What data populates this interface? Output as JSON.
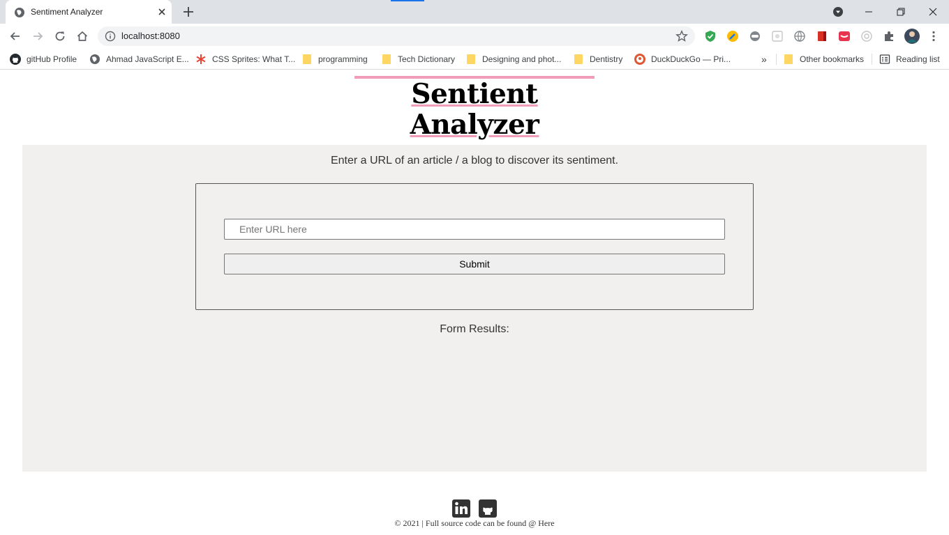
{
  "browser": {
    "tab_title": "Sentiment Analyzer",
    "address": "localhost:8080",
    "bookmarks": [
      {
        "label": "gitHub Profile",
        "icon": "github-icon"
      },
      {
        "label": "Ahmad JavaScript E...",
        "icon": "globe-icon"
      },
      {
        "label": "CSS Sprites: What T...",
        "icon": "asterisk-icon"
      },
      {
        "label": "programming",
        "icon": "folder-icon"
      },
      {
        "label": "Tech Dictionary",
        "icon": "folder-icon"
      },
      {
        "label": "Designing and phot...",
        "icon": "folder-icon"
      },
      {
        "label": "Dentistry",
        "icon": "folder-icon"
      },
      {
        "label": "DuckDuckGo — Pri...",
        "icon": "duckduckgo-icon"
      }
    ],
    "overflow": "»",
    "other_bookmarks": "Other bookmarks",
    "reading_list": "Reading list"
  },
  "page": {
    "title": "Sentient Analyzer",
    "intro": "Enter a URL of an article / a blog to discover its sentiment.",
    "url_placeholder": "Enter URL here",
    "submit_label": "Submit",
    "results_label": "Form Results:",
    "footer_text": "© 2021 | Full source code can be found @ Here"
  },
  "colors": {
    "accent": "#f19cbb",
    "panel_bg": "#f1f0ee",
    "tab_strip": "#dee1e6"
  }
}
